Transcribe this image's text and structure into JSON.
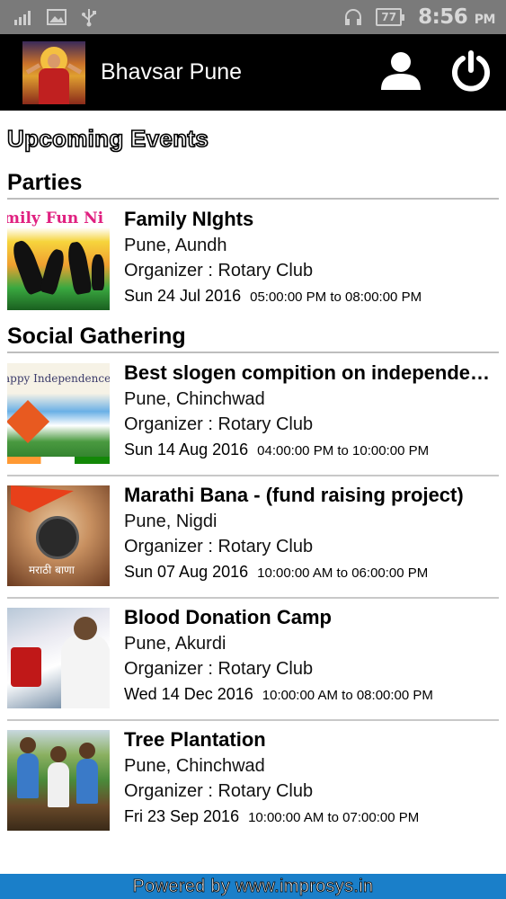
{
  "status_bar": {
    "battery": "77",
    "time": "8:56",
    "ampm": "PM"
  },
  "app_bar": {
    "title": "Bhavsar Pune"
  },
  "page": {
    "title": "Upcoming Events"
  },
  "sections": [
    {
      "name": "Parties",
      "events": [
        {
          "title": "Family NIghts",
          "location": "Pune, Aundh",
          "organizer": "Organizer : Rotary Club",
          "date": "Sun 24 Jul 2016",
          "time": "05:00:00 PM to 08:00:00 PM",
          "thumb_text": "mily Fun Ni"
        }
      ]
    },
    {
      "name": "Social Gathering",
      "events": [
        {
          "title": "Best slogen compition on independence day",
          "location": "Pune, Chinchwad",
          "organizer": "Organizer : Rotary Club",
          "date": "Sun 14 Aug 2016",
          "time": "04:00:00 PM to 10:00:00 PM",
          "thumb_text": "appy Independence Da"
        },
        {
          "title": "Marathi Bana - (fund raising project)",
          "location": "Pune, Nigdi",
          "organizer": "Organizer : Rotary Club",
          "date": "Sun 07 Aug 2016",
          "time": "10:00:00 AM to 06:00:00 PM",
          "thumb_text": "मराठी बाणा"
        },
        {
          "title": "Blood Donation Camp",
          "location": "Pune, Akurdi",
          "organizer": "Organizer : Rotary Club",
          "date": "Wed 14 Dec 2016",
          "time": "10:00:00 AM to 08:00:00 PM"
        },
        {
          "title": "Tree Plantation",
          "location": "Pune, Chinchwad",
          "organizer": "Organizer : Rotary Club",
          "date": "Fri 23 Sep 2016",
          "time": "10:00:00 AM to 07:00:00 PM"
        }
      ]
    }
  ],
  "footer": {
    "text": "Powered by www.improsys.in"
  },
  "colors": {
    "status_bar": "#7a7a7a",
    "app_bar": "#000000",
    "footer": "#1a7fc9",
    "divider": "#c8c8c8"
  },
  "icons": [
    "signal-icon",
    "image-icon",
    "usb-icon",
    "headset-icon",
    "battery-icon",
    "logo-image",
    "user-icon",
    "power-icon"
  ]
}
